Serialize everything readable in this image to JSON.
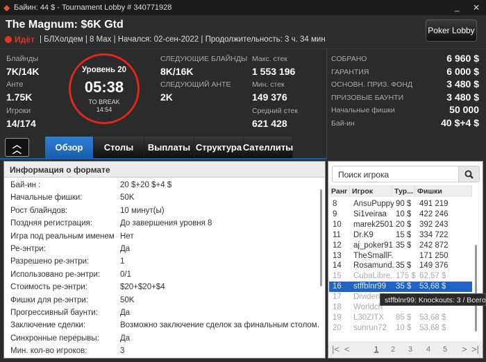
{
  "window": {
    "title": "Байин: 44 $ - Tournament Lobby # 340771928",
    "minimize": "_",
    "close": "✕"
  },
  "header": {
    "name": "The Magnum: $6K Gtd",
    "status": "Идёт",
    "details": "| БЛХолдем | 8 Max | Начался: 02-сен-2022 | Продолжительность: 3 ч. 34 мин",
    "lobby_button": "Poker Lobby",
    "status_color": "#e53228"
  },
  "stats": {
    "blinds_label": "Блайнды",
    "blinds": "7K/14K",
    "ante_label": "Анте",
    "ante": "1.75K",
    "players_label": "Игроки",
    "players": "14/174",
    "level": "Уровень 20",
    "timer": "05:38",
    "to_break_label": "TO BREAK",
    "to_break": "14:54",
    "next_blinds_label": "СЛЕДУЮЩИЕ БЛАЙНДЫ",
    "next_blinds": "8K/16K",
    "next_ante_label": "СЛЕДУЮЩИЙ АНТЕ",
    "next_ante": "2K",
    "max_stack_label": "Макс. стек",
    "max_stack": "1 553 196",
    "min_stack_label": "Мин. стек",
    "min_stack": "149 376",
    "avg_stack_label": "Средний стек",
    "avg_stack": "621 428"
  },
  "prize": [
    {
      "k": "СОБРАНО",
      "v": "6 960 $"
    },
    {
      "k": "ГАРАНТИЯ",
      "v": "6 000 $"
    },
    {
      "k": "ОСНОВН. ПРИЗ. ФОНД",
      "v": "3 480 $"
    },
    {
      "k": "ПРИЗОВЫЕ БАУНТИ",
      "v": "3 480 $"
    },
    {
      "k": "Начальные фишки",
      "v": "50 000"
    },
    {
      "k": "Бай-ин",
      "v": "40 $+4 $"
    }
  ],
  "tabs": [
    "Обзор",
    "Столы",
    "Выплаты",
    "Структура",
    "Сателлиты"
  ],
  "info": {
    "title": "Информация о формате",
    "rows": [
      {
        "k": "Бай-ин :",
        "v": "20 $+20 $+4 $"
      },
      {
        "k": "Начальные фишки:",
        "v": "50K"
      },
      {
        "k": "Рост блайндов:",
        "v": "10 минут(ы)"
      },
      {
        "k": "Поздняя регистрация:",
        "v": "До завершения уровня 8"
      },
      {
        "k": "Игра под реальным именем",
        "v": "Нет"
      },
      {
        "k": "Ре-энтри:",
        "v": "Да"
      },
      {
        "k": "Разрешено ре-энтри:",
        "v": "1"
      },
      {
        "k": "Использовано ре-энтри:",
        "v": "0/1"
      },
      {
        "k": "Стоимость ре-энтри:",
        "v": "$20+$20+$4"
      },
      {
        "k": "Фишки для ре-энтри:",
        "v": "50K"
      },
      {
        "k": "Прогрессивный баунти:",
        "v": "Да"
      },
      {
        "k": "Заключение сделки:",
        "v": "Возможно заключение сделок за финальным столом."
      },
      {
        "k": "Синхронные перерывы:",
        "v": "Да"
      },
      {
        "k": "Мин. кол-во игроков:",
        "v": "3"
      }
    ]
  },
  "players": {
    "search_placeholder": "Поиск игрока",
    "columns": [
      "Ранг",
      "Игрок",
      "Тур...",
      "Фишки"
    ],
    "rows": [
      {
        "r": "8",
        "n": "AnsuPuppy",
        "b": "90 $",
        "c": "491 219",
        "out": false
      },
      {
        "r": "9",
        "n": "Si1veiraa",
        "b": "10 $",
        "c": "422 246",
        "out": false
      },
      {
        "r": "10",
        "n": "marek2501",
        "b": "20 $",
        "c": "392 243",
        "out": false
      },
      {
        "r": "11",
        "n": "Dr.K9",
        "b": "15 $",
        "c": "334 722",
        "out": false
      },
      {
        "r": "12",
        "n": "aj_poker91...",
        "b": "35 $",
        "c": "242 872",
        "out": false
      },
      {
        "r": "13",
        "n": "TheSmallF...",
        "b": "",
        "c": "171 250",
        "out": false
      },
      {
        "r": "14",
        "n": "Rosamund...",
        "b": "35 $",
        "c": "149 376",
        "out": false
      },
      {
        "r": "15",
        "n": "CubaLibre...",
        "b": "175 $",
        "c": "62,57 $",
        "out": true
      },
      {
        "r": "16",
        "n": "stffblnr99",
        "b": "35 $",
        "c": "53,68 $",
        "out": true,
        "selected": true
      },
      {
        "r": "17",
        "n": "Dividend",
        "b": "",
        "c": "",
        "out": true
      },
      {
        "r": "18",
        "n": "Worldch",
        "b": "",
        "c": "",
        "out": true
      },
      {
        "r": "19",
        "n": "L30ZITX",
        "b": "85 $",
        "c": "53,68 $",
        "out": true
      },
      {
        "r": "20",
        "n": "sunrun72",
        "b": "10 $",
        "c": "53,68 $",
        "out": true
      }
    ],
    "pages": [
      "1",
      "2",
      "3",
      "4",
      "5"
    ],
    "current_page": "1",
    "tooltip": "stffblnr99: Knockouts: 3 / Всего"
  }
}
